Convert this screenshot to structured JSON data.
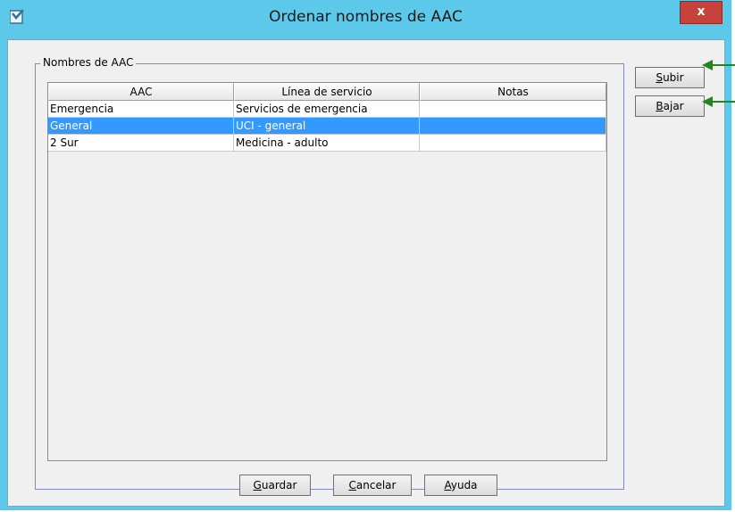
{
  "window": {
    "title": "Ordenar nombres de AAC",
    "close_label": "x"
  },
  "group": {
    "legend": "Nombres de AAC"
  },
  "table": {
    "columns": [
      "AAC",
      "Línea de servicio",
      "Notas"
    ],
    "rows": [
      {
        "aac": "Emergencia",
        "service_line": "Servicios de emergencia",
        "notes": "",
        "selected": false
      },
      {
        "aac": "General",
        "service_line": "UCI - general",
        "notes": "",
        "selected": true
      },
      {
        "aac": "2 Sur",
        "service_line": "Medicina - adulto",
        "notes": "",
        "selected": false
      }
    ]
  },
  "side_buttons": {
    "up": {
      "mnemonic": "S",
      "rest": "ubir"
    },
    "down": {
      "mnemonic": "B",
      "rest": "ajar"
    }
  },
  "bottom_buttons": {
    "save": {
      "mnemonic": "G",
      "rest": "uardar"
    },
    "cancel": {
      "mnemonic": "C",
      "rest": "ancelar"
    },
    "help": {
      "mnemonic": "A",
      "rest": "yuda"
    }
  },
  "colors": {
    "titlebar": "#5cc8ea",
    "selection": "#3399ff",
    "close": "#c7423a",
    "callout_arrow": "#1e8a1e"
  }
}
